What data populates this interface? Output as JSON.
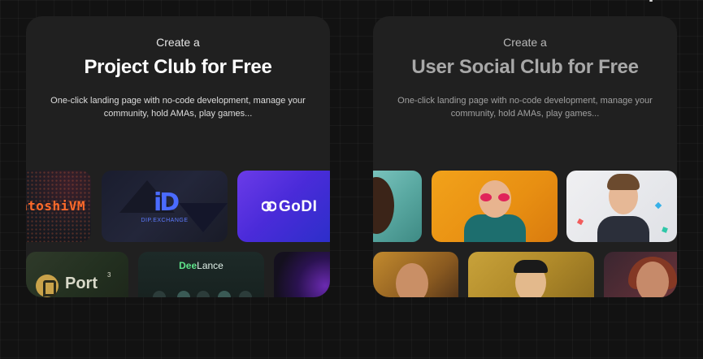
{
  "cards": [
    {
      "kicker": "Create a",
      "title": "Project Club for Free",
      "description": "One-click landing page with no-code development, manage your community, hold AMAs, play games...",
      "tiles": {
        "satoshi": "atoshiVM",
        "dip_logo": "iD",
        "dip_sub": "DIP.EXCHANGE",
        "godid": "GoDI",
        "port_name": "Port",
        "port_sup": "3",
        "deelance_a": "Dee",
        "deelance_b": "Lance"
      }
    },
    {
      "kicker": "Create a",
      "title": "User Social Club for Free",
      "description": "One-click landing page with no-code development, manage your community, hold AMAs, play games..."
    }
  ],
  "colors": {
    "background": "#121212",
    "card": "#202020",
    "title_active": "#ffffff",
    "title_muted": "#a8a8a8"
  },
  "icons": [
    "dip-exchange-logo",
    "godid-logo",
    "port3-logo",
    "deelance-logo"
  ]
}
